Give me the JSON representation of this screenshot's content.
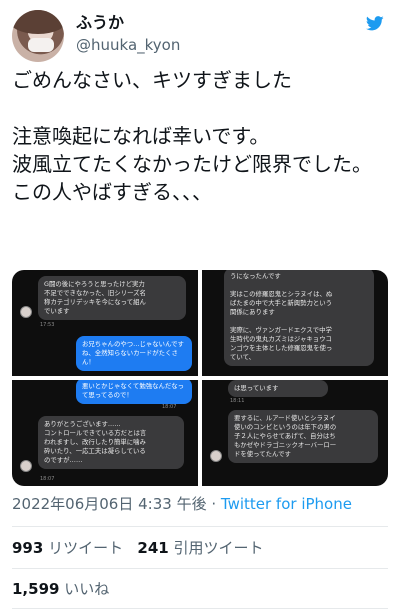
{
  "user": {
    "display_name": "ふうか",
    "handle": "@huuka_kyon"
  },
  "tweet": {
    "text": "ごめんなさい、キツすぎました\n\n注意喚起になれば幸いです。\n波風立てたくなかったけど限界でした。\nこの人やばすぎる、、、"
  },
  "media": {
    "p1": {
      "msg1": "G闘の後にやろうと思ったけど実力\n不足でできなかった、旧シリーズ名\n称カテゴリデッキを今になって組ん\nでいます",
      "time1": "17:53",
      "msg2": "お兄ちゃんのやつ…じゃないんです\nね、全然知らないカードがたくさ\nん！"
    },
    "p2": {
      "msg1": "うになったんです\n\n実はこの修羅忍鬼とシラヌイは、ぬ\nばたまの中で大手と新興勢力という\n関係にあります\n\n実際に、ヴァンガードエクスで中学\n生時代の鬼丸カズミはジャキョウコ\nンゴウを主体とした修羅忍鬼を使っ\nていて、"
    },
    "p3": {
      "msg1": "悪いとかじゃなくて勉強なんだなっ\nて思ってるので！",
      "time1": "18:07",
      "msg2": "ありがとうございます……\nコントロールできている方だとは言\nわれますし、改行したり簡単に噛み\n砕いたり、一応工夫は凝らしている\nのですが……",
      "time2": "18:07"
    },
    "p4": {
      "msg1": "は思っています",
      "time1": "18:11",
      "msg2": "要するに、ルアード使いとシラヌイ\n使いのコンビというのは年下の男の\n子２人にやらせてあげて、自分はち\nもかゼやドラゴニックオーバーロー\nドを使ってたんです"
    }
  },
  "meta": {
    "datetime": "2022年06月06日 4:33 午後",
    "separator": " · ",
    "source": "Twitter for iPhone"
  },
  "stats": {
    "retweets_count": "993",
    "retweets_label": "リツイート",
    "quotes_count": "241",
    "quotes_label": "引用ツイート",
    "likes_count": "1,599",
    "likes_label": "いいね"
  },
  "colors": {
    "accent": "#1d9bf0",
    "bubble_blue": "#1e7cf2",
    "bubble_gray": "#3a3a3c"
  }
}
